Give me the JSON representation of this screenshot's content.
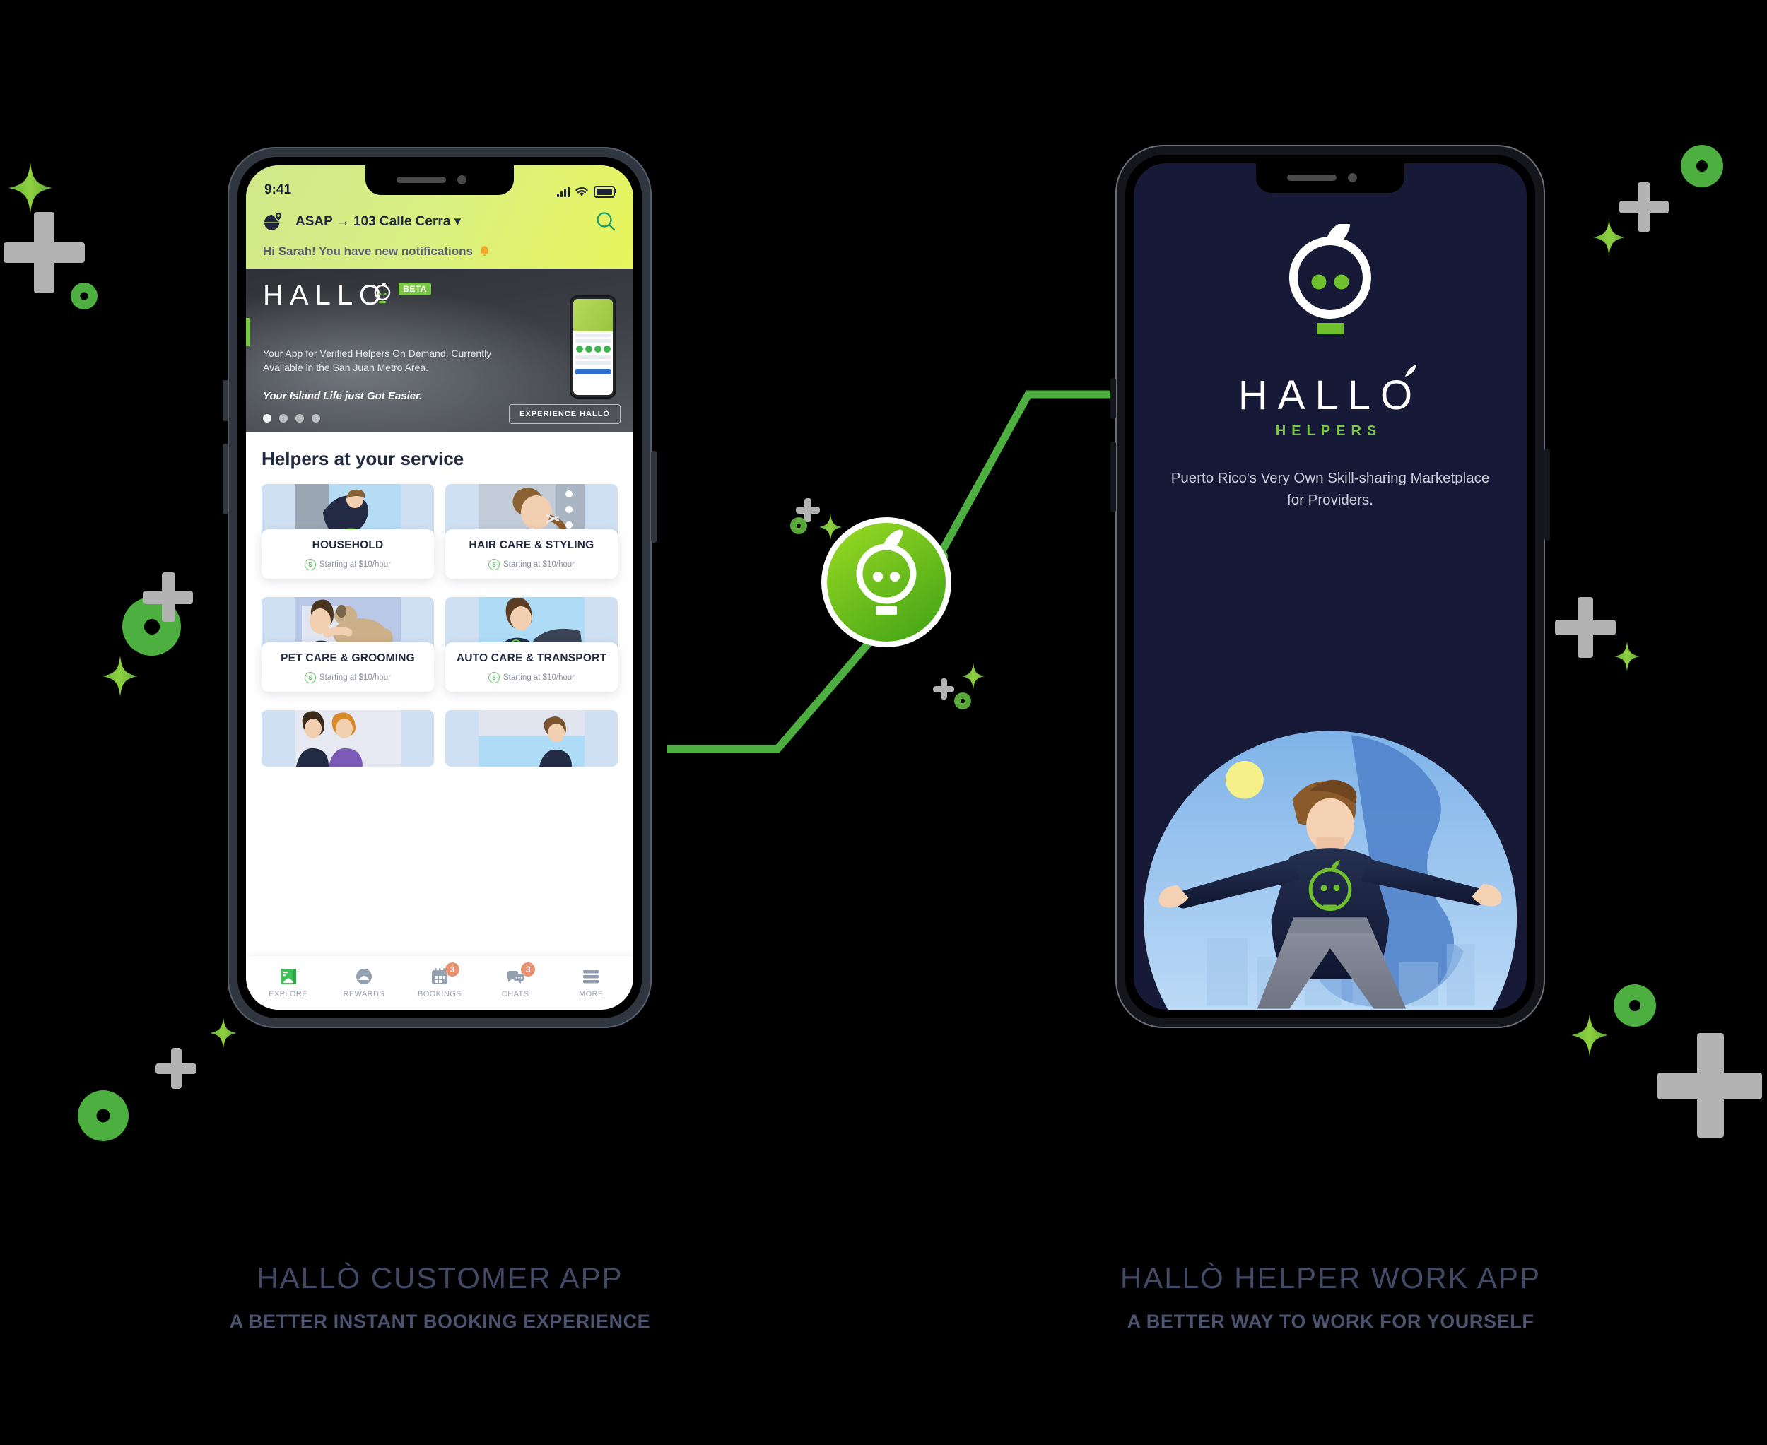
{
  "colors": {
    "brand_green": "#7ac943",
    "accent_green": "#4caf3f",
    "deco_gray": "#b3b3b3",
    "dark_navy": "#171a36",
    "caption": "#434a66",
    "badge": "#e8916f"
  },
  "phone1": {
    "status": {
      "time": "9:41",
      "signal_icon": "cellular-bars-icon",
      "wifi_icon": "wifi-icon",
      "battery_icon": "battery-icon"
    },
    "location": {
      "globe_icon": "globe-pin-icon",
      "text": "ASAP → 103 Calle Cerra ▾",
      "search_icon": "search-icon"
    },
    "greeting": {
      "text": "Hi Sarah! You have new notifications",
      "bell_icon": "bell-icon"
    },
    "banner": {
      "brand": "HALLO",
      "badge": "BETA",
      "subtitle": "Your App for Verified Helpers On Demand. Currently Available in the San Juan Metro Area.",
      "tagline": "Your Island Life just Got Easier.",
      "cta": "EXPERIENCE HALLÒ",
      "dots": 4,
      "active_dot": 0
    },
    "section_title": "Helpers at your service",
    "cards": [
      {
        "name": "HOUSEHOLD",
        "price": "Starting at $10/hour",
        "coin_icon": "dollar-coin-icon"
      },
      {
        "name": "HAIR CARE & STYLING",
        "price": "Starting at $10/hour",
        "coin_icon": "dollar-coin-icon"
      },
      {
        "name": "PET CARE & GROOMING",
        "price": "Starting at $10/hour",
        "coin_icon": "dollar-coin-icon"
      },
      {
        "name": "AUTO CARE & TRANSPORT",
        "price": "Starting at $10/hour",
        "coin_icon": "dollar-coin-icon"
      }
    ],
    "tabs": [
      {
        "label": "EXPLORE",
        "icon": "explore-book-icon",
        "badge": "",
        "active": true
      },
      {
        "label": "REWARDS",
        "icon": "rewards-tray-icon",
        "badge": "",
        "active": false
      },
      {
        "label": "BOOKINGS",
        "icon": "calendar-icon",
        "badge": "3",
        "active": false
      },
      {
        "label": "CHATS",
        "icon": "chat-bubbles-icon",
        "badge": "3",
        "active": false
      },
      {
        "label": "MORE",
        "icon": "hamburger-menu-icon",
        "badge": "",
        "active": false
      }
    ]
  },
  "phone2": {
    "logo_icon": "hallo-face-logo-icon",
    "brand": "HALLO",
    "sub_brand": "HELPERS",
    "description": "Puerto Rico's Very Own Skill-sharing Marketplace for Providers.",
    "illustration": "helper-person-globe-illustration"
  },
  "center_badge": {
    "icon": "hallo-face-badge-icon"
  },
  "captions": [
    {
      "title": "HALLÒ CUSTOMER APP",
      "subtitle": "A BETTER INSTANT BOOKING EXPERIENCE"
    },
    {
      "title": "HALLÒ HELPER WORK APP",
      "subtitle": "A BETTER WAY TO WORK FOR YOURSELF"
    }
  ]
}
